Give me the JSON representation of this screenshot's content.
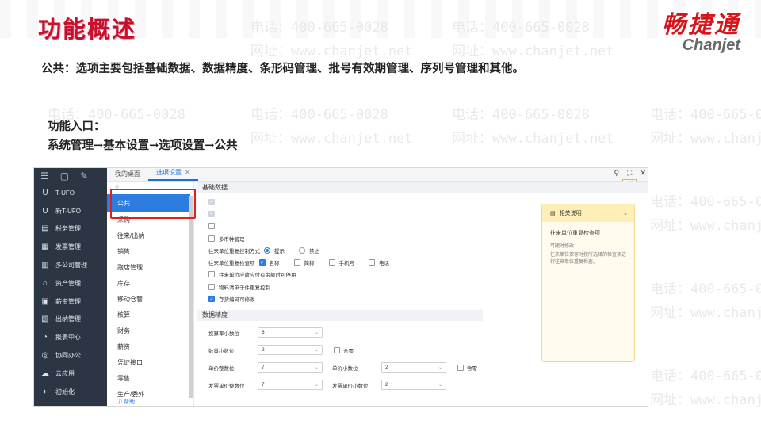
{
  "slide": {
    "title": "功能概述",
    "description": "公共：选项主要包括基础数据、数据精度、条形码管理、批号有效期管理、序列号管理和其他。",
    "entry_label": "功能入口：",
    "entry_path": "系统管理→基本设置→选项设置→公共"
  },
  "logo": {
    "cn": "畅捷通",
    "en": "Chanjet"
  },
  "watermark": {
    "phone": "电话：400-665-0028",
    "site": "网址：www.chanjet.net"
  },
  "app": {
    "nav_items": [
      {
        "label": "T-UFO",
        "icon": "ufo-icon",
        "glyph": "U"
      },
      {
        "label": "新T-UFO",
        "icon": "ufo-new-icon",
        "glyph": "U"
      },
      {
        "label": "税务管理",
        "icon": "tax-icon",
        "glyph": "▤"
      },
      {
        "label": "发票管理",
        "icon": "invoice-icon",
        "glyph": "▦"
      },
      {
        "label": "多公司管理",
        "icon": "company-icon",
        "glyph": "▥"
      },
      {
        "label": "资产管理",
        "icon": "asset-icon",
        "glyph": "⌂"
      },
      {
        "label": "薪资管理",
        "icon": "salary-icon",
        "glyph": "▣"
      },
      {
        "label": "出纳管理",
        "icon": "cashier-icon",
        "glyph": "▧"
      },
      {
        "label": "报表中心",
        "icon": "report-icon",
        "glyph": "◔"
      },
      {
        "label": "协同办公",
        "icon": "collab-icon",
        "glyph": "◎"
      },
      {
        "label": "云应用",
        "icon": "cloud-icon",
        "glyph": "☁"
      },
      {
        "label": "初始化",
        "icon": "init-icon",
        "glyph": "◐"
      }
    ],
    "tabs": [
      {
        "label": "我的桌面"
      },
      {
        "label": "选项设置"
      }
    ],
    "help_tag": "客服",
    "sub_nav": {
      "items": [
        "公共",
        "采购",
        "往来/出纳",
        "销售",
        "跑店管理",
        "库存",
        "移动仓管",
        "核算",
        "财务",
        "薪资",
        "凭证接口",
        "零售",
        "生产/委外"
      ],
      "footer": "帮助"
    },
    "sections": {
      "basic_title": "基础数据",
      "precision_title": "数据精度"
    },
    "options": {
      "multi_currency": "多币种管理",
      "dup_control_label": "往来单位重复控制方式",
      "dup_control_prompt": "提示",
      "dup_control_forbid": "禁止",
      "dup_check_label": "往来单位重复检查项",
      "check_name": "名称",
      "check_short": "简称",
      "check_mobile": "手机号",
      "check_phone": "电话",
      "due_no_balance": "往来单位应收应付有余额时可停用",
      "bom_dup": "物料清单子件重复控制",
      "stock_code_edit": "存货编码可修改"
    },
    "precision": {
      "conv_rate": {
        "label": "换算率小数位",
        "value": "6"
      },
      "qty": {
        "label": "数量小数位",
        "value": "2",
        "tail": "舍零"
      },
      "unit_price_int": {
        "label": "单价整数位",
        "value": "7"
      },
      "unit_price_dec": {
        "label": "单价小数位",
        "value": "2",
        "tail": "舍零"
      },
      "inv_price_int": {
        "label": "发票单价整数位",
        "value": "7"
      },
      "inv_price_dec": {
        "label": "发票单价小数位",
        "value": "2"
      }
    },
    "help_panel": {
      "head": "相关说明",
      "title": "往来单位重复检查项",
      "body": "可随时修改\n往来单位保存时按所选择的检查项进行往来单位重复检查。"
    }
  },
  "colors": {
    "accent": "#2d7ce0",
    "title_red": "#c8102e",
    "nav_bg": "#2b3544"
  }
}
